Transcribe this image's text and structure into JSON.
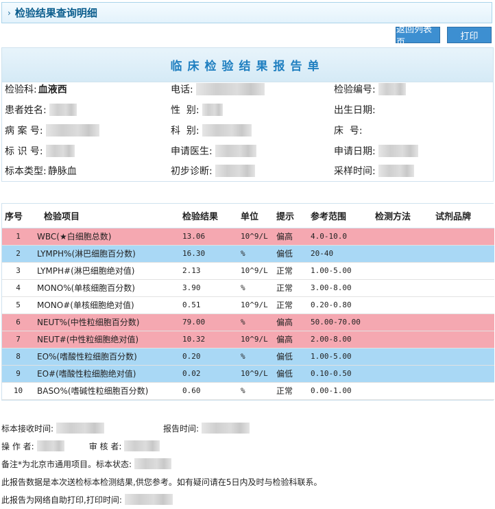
{
  "page": {
    "title": "检验结果查询明细"
  },
  "toolbar": {
    "back_label": "返回列表页",
    "print_label": "打印"
  },
  "report": {
    "heading": "临床检验结果报告单",
    "fields": {
      "dept_label": "检验科:",
      "dept_value": "血液西",
      "phone_label": "电话:",
      "test_no_label": "检验编号:",
      "patient_name_label": "患者姓名:",
      "gender_label": "性  别:",
      "birth_label": "出生日期:",
      "record_no_label": "病 案 号:",
      "ward_label": "科  别:",
      "bed_label": "床  号:",
      "id_no_label": "标 识 号:",
      "doctor_label": "申请医生:",
      "apply_date_label": "申请日期:",
      "sample_type_label": "标本类型:",
      "sample_type_value": "静脉血",
      "diagnosis_label": "初步诊断:",
      "sample_time_label": "采样时间:"
    }
  },
  "table": {
    "headers": [
      "序号",
      "检验项目",
      "检验结果",
      "单位",
      "提示",
      "参考范围",
      "检测方法",
      "试剂品牌"
    ],
    "rows": [
      {
        "no": "1",
        "item": "WBC(★白细胞总数)",
        "result": "13.06",
        "unit": "10^9/L",
        "hint": "偏高",
        "range": "4.0-10.0",
        "status": "high"
      },
      {
        "no": "2",
        "item": "LYMPH%(淋巴细胞百分数)",
        "result": "16.30",
        "unit": "%",
        "hint": "偏低",
        "range": "20-40",
        "status": "low"
      },
      {
        "no": "3",
        "item": "LYMPH#(淋巴细胞绝对值)",
        "result": "2.13",
        "unit": "10^9/L",
        "hint": "正常",
        "range": "1.00-5.00",
        "status": "normal"
      },
      {
        "no": "4",
        "item": "MONO%(单核细胞百分数)",
        "result": "3.90",
        "unit": "%",
        "hint": "正常",
        "range": "3.00-8.00",
        "status": "normal"
      },
      {
        "no": "5",
        "item": "MONO#(单核细胞绝对值)",
        "result": "0.51",
        "unit": "10^9/L",
        "hint": "正常",
        "range": "0.20-0.80",
        "status": "normal"
      },
      {
        "no": "6",
        "item": "NEUT%(中性粒细胞百分数)",
        "result": "79.00",
        "unit": "%",
        "hint": "偏高",
        "range": "50.00-70.00",
        "status": "high"
      },
      {
        "no": "7",
        "item": "NEUT#(中性粒细胞绝对值)",
        "result": "10.32",
        "unit": "10^9/L",
        "hint": "偏高",
        "range": "2.00-8.00",
        "status": "high"
      },
      {
        "no": "8",
        "item": "EO%(嗜酸性粒细胞百分数)",
        "result": "0.20",
        "unit": "%",
        "hint": "偏低",
        "range": "1.00-5.00",
        "status": "low"
      },
      {
        "no": "9",
        "item": "EO#(嗜酸性粒细胞绝对值)",
        "result": "0.02",
        "unit": "10^9/L",
        "hint": "偏低",
        "range": "0.10-0.50",
        "status": "low"
      },
      {
        "no": "10",
        "item": "BASO%(嗜碱性粒细胞百分数)",
        "result": "0.60",
        "unit": "%",
        "hint": "正常",
        "range": "0.00-1.00",
        "status": "normal"
      }
    ]
  },
  "footer": {
    "receive_time_label": "标本接收时间:",
    "report_time_label": "报告时间:",
    "operator_label": "操 作 者:",
    "reviewer_label": "审 核 者:",
    "note_label": "备注*为北京市通用项目。标本状态:",
    "disclaimer": "此报告数据是本次送检标本检测结果,供您参考。如有疑问请在5日内及时与检验科联系。",
    "print_label": "此报告为网络自助打印,打印时间:"
  },
  "colors": {
    "high_row": "#f5a8b1",
    "low_row": "#a9d8f5",
    "accent": "#3d8fd1",
    "title": "#0b5d8d"
  }
}
